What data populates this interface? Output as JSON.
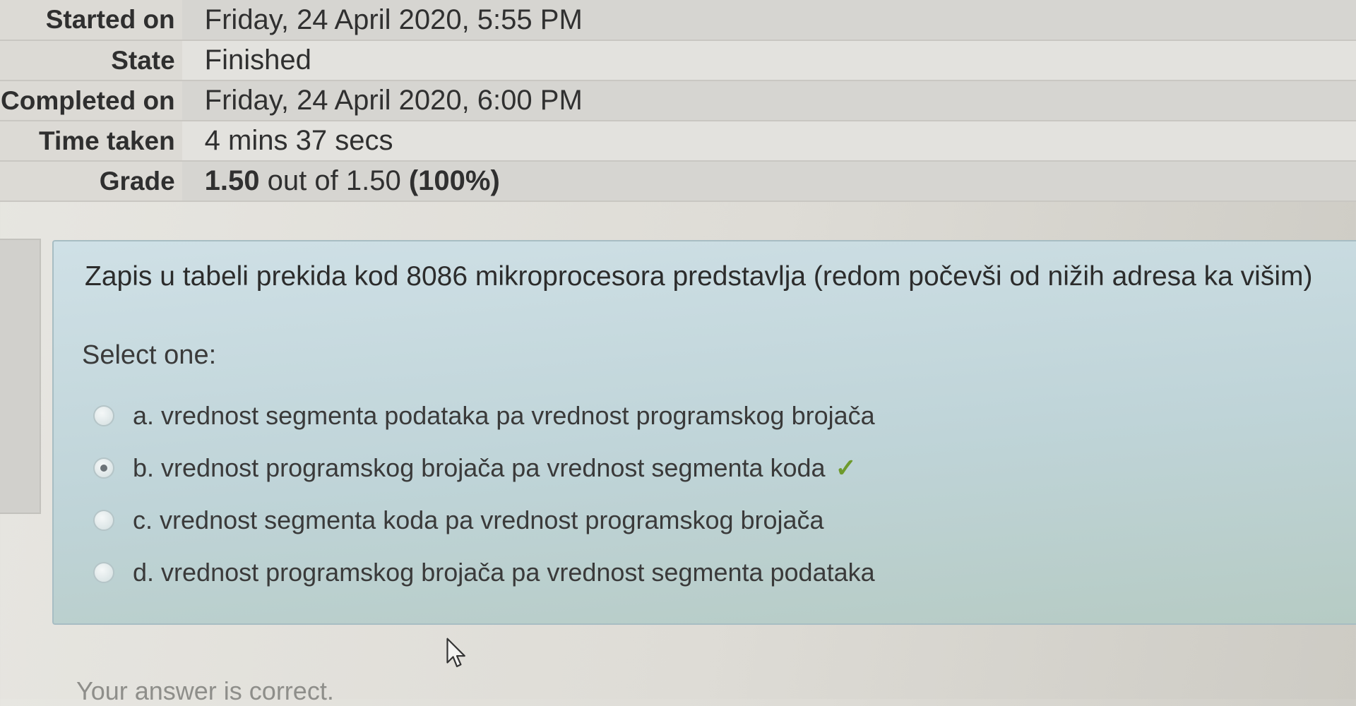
{
  "summary": {
    "rows": [
      {
        "label": "Started on",
        "value": "Friday, 24 April 2020, 5:55 PM"
      },
      {
        "label": "State",
        "value": "Finished"
      },
      {
        "label": "Completed on",
        "value": "Friday, 24 April 2020, 6:00 PM"
      },
      {
        "label": "Time taken",
        "value": "4 mins 37 secs"
      }
    ],
    "grade": {
      "label": "Grade",
      "score": "1.50",
      "out_of_text": "out of 1.50",
      "percent": "(100%)"
    }
  },
  "question": {
    "text": "Zapis u tabeli prekida kod 8086 mikroprocesora predstavlja (redom počevši od nižih adresa ka višim)",
    "prompt": "Select one:",
    "options": [
      {
        "letter": "a.",
        "text": "vrednost segmenta podataka pa vrednost programskog brojača",
        "selected": false
      },
      {
        "letter": "b.",
        "text": "vrednost programskog brojača pa vrednost segmenta koda",
        "selected": true,
        "correct_icon": "check-icon"
      },
      {
        "letter": "c.",
        "text": "vrednost segmenta koda pa vrednost programskog brojača",
        "selected": false
      },
      {
        "letter": "d.",
        "text": "vrednost programskog brojača pa vrednost segmenta podataka",
        "selected": false
      }
    ],
    "correct_mark": "✓",
    "feedback": "Your answer is correct."
  },
  "colors": {
    "question_background": "#c6dadf",
    "correct_check": "#6e9a2c"
  }
}
